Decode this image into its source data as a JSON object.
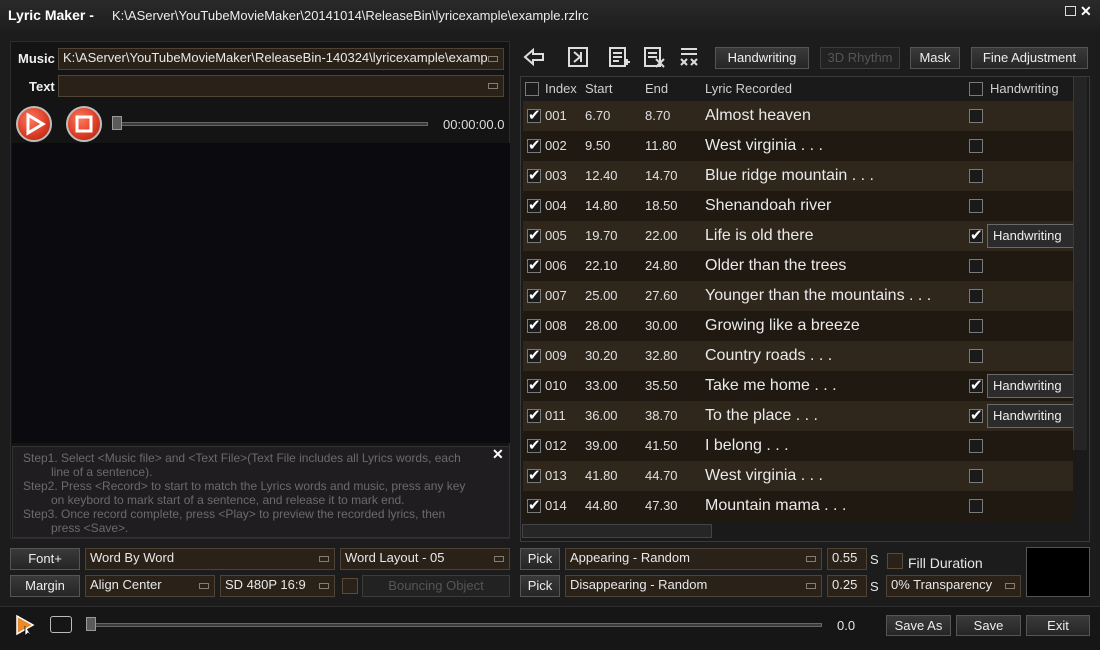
{
  "window": {
    "app_title": "Lyric Maker -",
    "file_path": "K:\\AServer\\YouTubeMovieMaker\\20141014\\ReleaseBin\\lyricexample\\example.rzlrc"
  },
  "left_panel": {
    "music_label": "Music",
    "music_value": "K:\\AServer\\YouTubeMovieMaker\\ReleaseBin-140324\\lyricexample\\examp",
    "text_label": "Text",
    "text_value": "",
    "time_display": "00:00:00.0",
    "help_steps": [
      {
        "line1": "Step1. Select <Music file> and <Text File>(Text File includes all Lyrics words, each",
        "line2": "line of a sentence)."
      },
      {
        "line1": "Step2. Press <Record> to start to match the Lyrics words and music, press any key",
        "line2": "on keybord to mark start of a sentence, and release it to mark end."
      },
      {
        "line1": "Step3. Once record complete, press <Play> to preview the recorded lyrics, then",
        "line2": "press <Save>."
      }
    ]
  },
  "toolbar": {
    "handwriting": "Handwriting",
    "rhythm_3d": "3D Rhythm",
    "mask": "Mask",
    "fine_adjustment": "Fine Adjustment"
  },
  "grid": {
    "headers": {
      "index": "Index",
      "start": "Start",
      "end": "End",
      "lyric": "Lyric Recorded",
      "handwriting": "Handwriting"
    },
    "rows": [
      {
        "index": "001",
        "start": "6.70",
        "end": "8.70",
        "lyric": "Almost heaven",
        "checked": true,
        "hw": false
      },
      {
        "index": "002",
        "start": "9.50",
        "end": "11.80",
        "lyric": "West virginia . . .",
        "checked": true,
        "hw": false
      },
      {
        "index": "003",
        "start": "12.40",
        "end": "14.70",
        "lyric": "Blue ridge mountain . . .",
        "checked": true,
        "hw": false
      },
      {
        "index": "004",
        "start": "14.80",
        "end": "18.50",
        "lyric": "Shenandoah river",
        "checked": true,
        "hw": false
      },
      {
        "index": "005",
        "start": "19.70",
        "end": "22.00",
        "lyric": "Life is old there",
        "checked": true,
        "hw": true
      },
      {
        "index": "006",
        "start": "22.10",
        "end": "24.80",
        "lyric": "Older than the trees",
        "checked": true,
        "hw": false
      },
      {
        "index": "007",
        "start": "25.00",
        "end": "27.60",
        "lyric": "Younger than the mountains . . .",
        "checked": true,
        "hw": false
      },
      {
        "index": "008",
        "start": "28.00",
        "end": "30.00",
        "lyric": "Growing like a breeze",
        "checked": true,
        "hw": false
      },
      {
        "index": "009",
        "start": "30.20",
        "end": "32.80",
        "lyric": "Country roads . . .",
        "checked": true,
        "hw": false
      },
      {
        "index": "010",
        "start": "33.00",
        "end": "35.50",
        "lyric": "Take me home . . .",
        "checked": true,
        "hw": true
      },
      {
        "index": "011",
        "start": "36.00",
        "end": "38.70",
        "lyric": "To the place . . .",
        "checked": true,
        "hw": true
      },
      {
        "index": "012",
        "start": "39.00",
        "end": "41.50",
        "lyric": "I belong . . .",
        "checked": true,
        "hw": false
      },
      {
        "index": "013",
        "start": "41.80",
        "end": "44.70",
        "lyric": "West virginia . . .",
        "checked": true,
        "hw": false
      },
      {
        "index": "014",
        "start": "44.80",
        "end": "47.30",
        "lyric": "Mountain mama . . .",
        "checked": true,
        "hw": false
      }
    ],
    "hw_button_label": "Handwriting"
  },
  "bottom_controls": {
    "font_btn": "Font+",
    "margin_btn": "Margin",
    "word_mode": "Word By Word",
    "word_layout": "Word Layout - 05",
    "align": "Align Center",
    "resolution": "SD 480P 16:9",
    "bouncing": "Bouncing Object",
    "pick1": "Pick",
    "pick2": "Pick",
    "appearing": "Appearing - Random",
    "disappearing": "Disappearing - Random",
    "appear_sec": "0.55",
    "disappear_sec": "0.25",
    "sec_unit": "S",
    "fill_duration": "Fill Duration",
    "transparency": "0% Transparency"
  },
  "footer": {
    "position": "0.0",
    "save_as": "Save As",
    "save": "Save",
    "exit": "Exit"
  },
  "colors": {
    "accent": "#e8892a",
    "record_red": "#d83a22",
    "row_odd": "#2f261c",
    "row_even": "#1f1912"
  }
}
